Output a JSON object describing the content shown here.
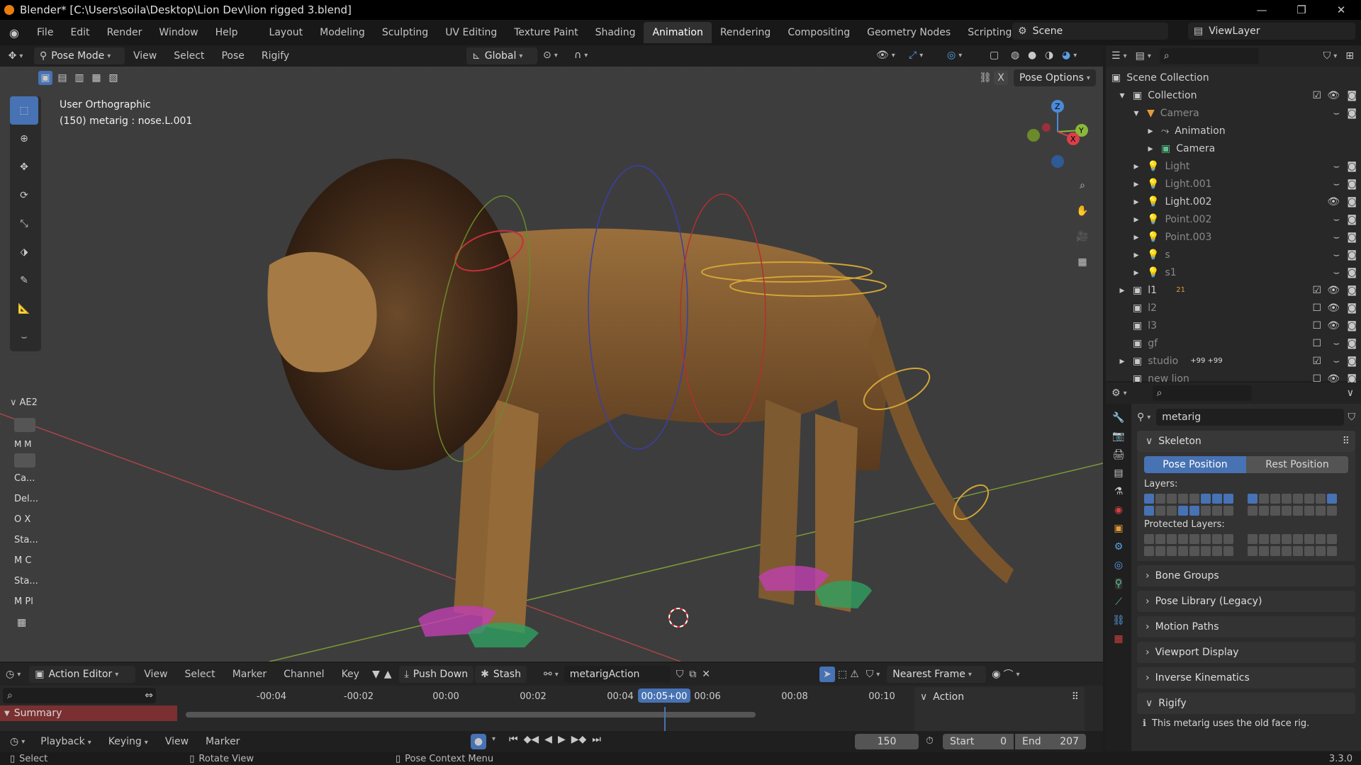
{
  "title": "Blender* [C:\\Users\\soila\\Desktop\\Lion Dev\\lion rigged 3.blend]",
  "menu": [
    "File",
    "Edit",
    "Render",
    "Window",
    "Help"
  ],
  "workspaces": [
    "Layout",
    "Modeling",
    "Sculpting",
    "UV Editing",
    "Texture Paint",
    "Shading",
    "Animation",
    "Rendering",
    "Compositing",
    "Geometry Nodes",
    "Scripting"
  ],
  "active_workspace": "Animation",
  "scene": "Scene",
  "view_layer": "ViewLayer",
  "viewport": {
    "mode": "Pose Mode",
    "menus": [
      "View",
      "Select",
      "Pose",
      "Rigify"
    ],
    "transform": "Global",
    "pose_options": "Pose Options",
    "view_name": "User Orthographic",
    "object_info": "(150) metarig : nose.L.001",
    "side_tab": "AE2",
    "side_buttons": [
      "M M",
      "Ca...",
      "Del...",
      "O X",
      "Sta...",
      "M C",
      "Sta...",
      "M Pl"
    ]
  },
  "outliner": {
    "rows": [
      {
        "label": "Scene Collection"
      },
      {
        "label": "Collection"
      },
      {
        "label": "Camera"
      },
      {
        "label": "Animation"
      },
      {
        "label": "Camera"
      },
      {
        "label": "Light"
      },
      {
        "label": "Light.001"
      },
      {
        "label": "Light.002"
      },
      {
        "label": "Point.002"
      },
      {
        "label": "Point.003"
      },
      {
        "label": "s"
      },
      {
        "label": "s1"
      },
      {
        "label": "l1",
        "badge": "21"
      },
      {
        "label": "l2"
      },
      {
        "label": "l3"
      },
      {
        "label": "gf"
      },
      {
        "label": "studio",
        "badge": "+99 +99"
      },
      {
        "label": "new lion"
      }
    ]
  },
  "properties": {
    "object": "metarig",
    "skeleton": "Skeleton",
    "pose_position": "Pose Position",
    "rest_position": "Rest Position",
    "layers": "Layers:",
    "protected_layers": "Protected Layers:",
    "panels": [
      "Bone Groups",
      "Pose Library (Legacy)",
      "Motion Paths",
      "Viewport Display",
      "Inverse Kinematics",
      "Rigify"
    ],
    "rigify_note": "This metarig uses the old face rig."
  },
  "action_editor": {
    "mode": "Action Editor",
    "menus": [
      "View",
      "Select",
      "Marker",
      "Channel",
      "Key"
    ],
    "push_down": "Push Down",
    "stash": "Stash",
    "action": "metarigAction",
    "snap": "Nearest Frame",
    "summary": "Summary",
    "ticks": [
      "-00:04",
      "-00:02",
      "00:00",
      "00:02",
      "00:04",
      "00:06",
      "00:08",
      "00:10"
    ],
    "current": "00:05+00",
    "side_panel": "Action"
  },
  "timeline": {
    "menus": [
      "Playback",
      "Keying",
      "View",
      "Marker"
    ],
    "frame": "150",
    "start_label": "Start",
    "start": "0",
    "end_label": "End",
    "end": "207"
  },
  "status": {
    "select": "Select",
    "rotate": "Rotate View",
    "context": "Pose Context Menu",
    "version": "3.3.0"
  }
}
